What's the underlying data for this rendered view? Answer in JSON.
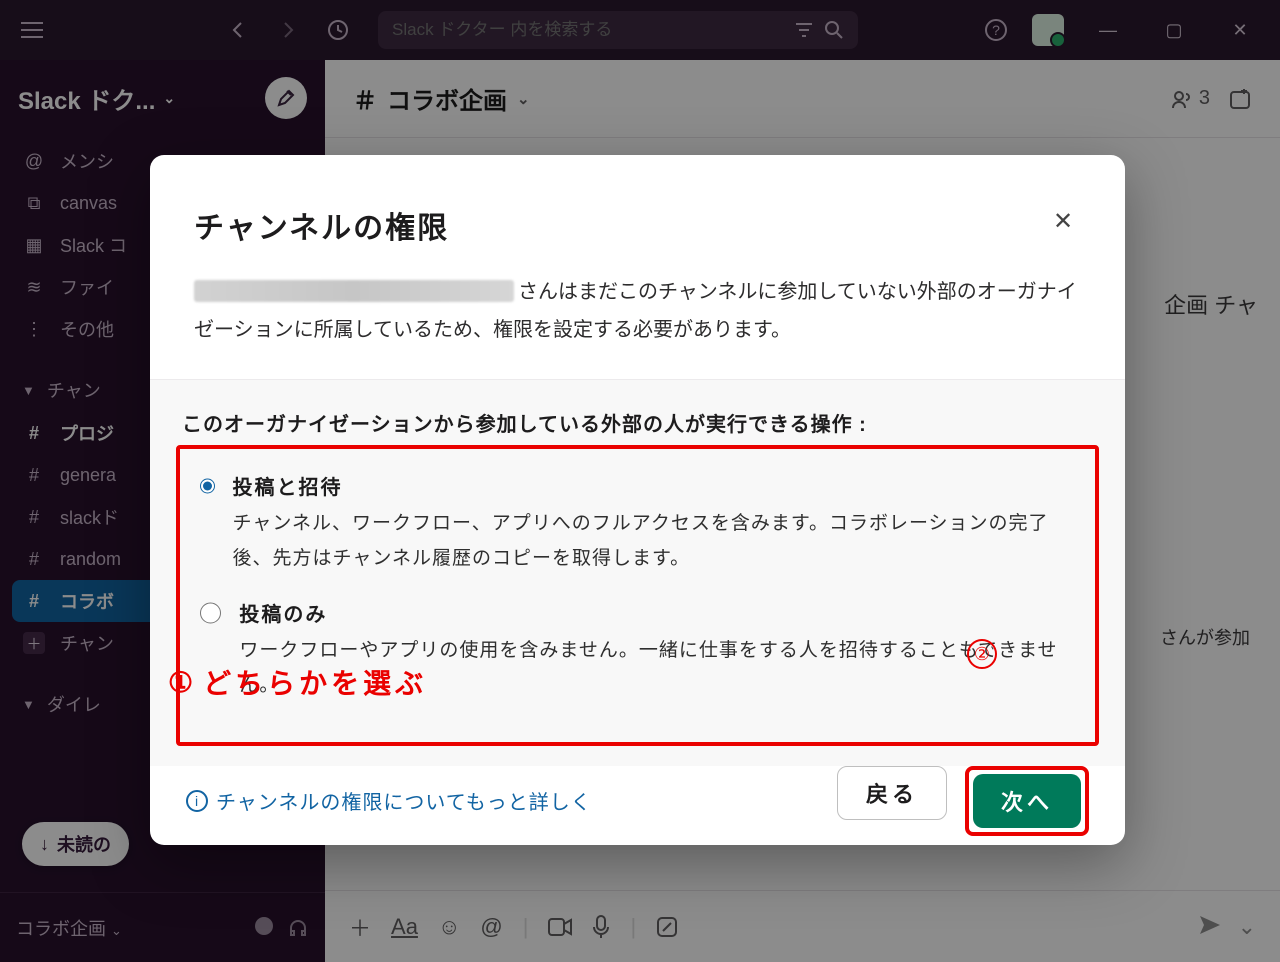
{
  "titlebar": {
    "search_placeholder": "Slack ドクター 内を検索する"
  },
  "sidebar": {
    "workspace_name": "Slack ドク...",
    "items_top": [
      {
        "icon": "@",
        "label": "メンシ"
      },
      {
        "icon": "⧉",
        "label": "canvas"
      },
      {
        "icon": "▦",
        "label": "Slack コ"
      },
      {
        "icon": "≋",
        "label": "ファイ"
      },
      {
        "icon": "⋮",
        "label": "その他"
      }
    ],
    "channels_header": "チャン",
    "channels": [
      {
        "label": "プロジ",
        "bold": true
      },
      {
        "label": "genera"
      },
      {
        "label": "slackド"
      },
      {
        "label": "random"
      },
      {
        "label": "コラボ",
        "active": true
      }
    ],
    "add_channel": "チャン",
    "dm_header": "ダイレ",
    "unread_pill": "未読の",
    "footer_channel": "コラボ企画"
  },
  "channel": {
    "name": "コラボ企画",
    "member_count": "3",
    "bg_text": "企画 チャ",
    "joined_text": "さんが参加"
  },
  "modal": {
    "title": "チャンネルの権限",
    "desc_after_blur": "さんはまだこのチャンネルに参加していない外部のオーガナイゼーションに所属しているため、権限を設定する必要があります。",
    "perm_label": "このオーガナイゼーションから参加している外部の人が実行できる操作 :",
    "options": [
      {
        "title": "投稿と招待",
        "desc": "チャンネル、ワークフロー、アプリへのフルアクセスを含みます。コラボレーションの完了後、先方はチャンネル履歴のコピーを取得します。",
        "checked": true
      },
      {
        "title": "投稿のみ",
        "desc": "ワークフローやアプリの使用を含みません。一緒に仕事をする人を招待することもできません。",
        "checked": false
      }
    ],
    "learn_more": "チャンネルの権限についてもっと詳しく",
    "back": "戻る",
    "next": "次へ",
    "annot1": "どちらかを選ぶ",
    "annot1_num": "①",
    "annot2_num": "②"
  }
}
